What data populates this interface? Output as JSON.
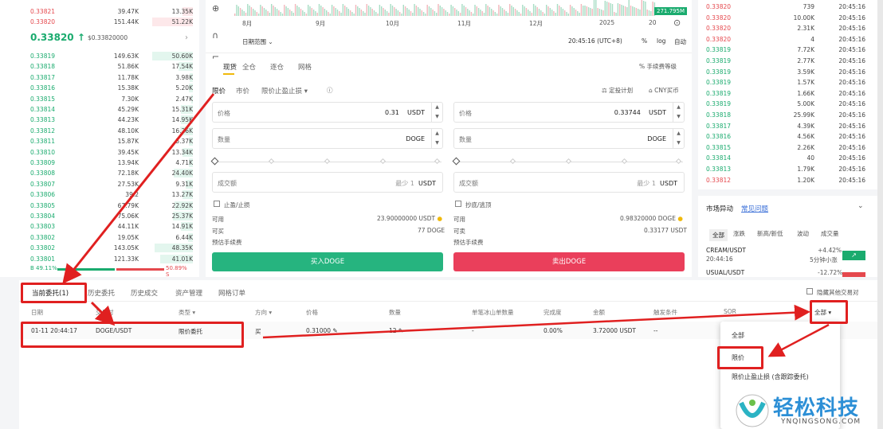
{
  "colors": {
    "red": "#e5484d",
    "green": "#1aab6e",
    "buy_button": "#26b47f",
    "sell_button": "#ea3f5b",
    "annotation": "#e02020"
  },
  "orderbook_left": {
    "asks_top": [
      {
        "price": "0.33821",
        "qty": "39.47K",
        "total": "13.35K"
      },
      {
        "price": "0.33820",
        "qty": "151.44K",
        "total": "51.22K"
      }
    ],
    "mid_price": "0.33820",
    "mid_arrow": "↑",
    "mid_sub": "$0.33820000",
    "bids": [
      {
        "price": "0.33819",
        "qty": "149.63K",
        "total": "50.60K"
      },
      {
        "price": "0.33818",
        "qty": "51.86K",
        "total": "17.54K"
      },
      {
        "price": "0.33817",
        "qty": "11.78K",
        "total": "3.98K"
      },
      {
        "price": "0.33816",
        "qty": "15.38K",
        "total": "5.20K"
      },
      {
        "price": "0.33815",
        "qty": "7.30K",
        "total": "2.47K"
      },
      {
        "price": "0.33814",
        "qty": "45.29K",
        "total": "15.31K"
      },
      {
        "price": "0.33813",
        "qty": "44.23K",
        "total": "14.95K"
      },
      {
        "price": "0.33812",
        "qty": "48.10K",
        "total": "16.26K"
      },
      {
        "price": "0.33811",
        "qty": "15.87K",
        "total": "5.37K"
      },
      {
        "price": "0.33810",
        "qty": "39.45K",
        "total": "13.34K"
      },
      {
        "price": "0.33809",
        "qty": "13.94K",
        "total": "4.71K"
      },
      {
        "price": "0.33808",
        "qty": "72.18K",
        "total": "24.40K"
      },
      {
        "price": "0.33807",
        "qty": "27.53K",
        "total": "9.31K"
      },
      {
        "price": "0.33806",
        "qty": "39.2",
        "total": "13.27K"
      },
      {
        "price": "0.33805",
        "qty": "67.79K",
        "total": "22.92K"
      },
      {
        "price": "0.33804",
        "qty": "75.06K",
        "total": "25.37K"
      },
      {
        "price": "0.33803",
        "qty": "44.11K",
        "total": "14.91K"
      },
      {
        "price": "0.33802",
        "qty": "19.05K",
        "total": "6.44K"
      },
      {
        "price": "0.33802",
        "qty": "143.05K",
        "total": "48.35K"
      },
      {
        "price": "0.33801",
        "qty": "121.33K",
        "total": "41.01K"
      }
    ],
    "ratio_buy": "B 49.11%",
    "ratio_sell": "50.89% S"
  },
  "center": {
    "volume_badge": "271.795M",
    "x_ticks": [
      "8月",
      "9月",
      "10月",
      "11月",
      "12月",
      "2025",
      "20"
    ],
    "date_range": "日期范围",
    "time": "20:45:16 (UTC+8)",
    "percent": "%",
    "log": "log",
    "auto": "自动",
    "mode_tabs": [
      "现货",
      "全仓",
      "逐仓",
      "网格"
    ],
    "fee_level": "手续费等级",
    "order_types": [
      "限价",
      "市价",
      "限价止盈止损"
    ],
    "strategy": "定投计划",
    "cny": "CNY买币",
    "buy_form": {
      "price_label": "价格",
      "price_value": "0.31",
      "price_unit": "USDT",
      "qty_label": "数量",
      "qty_unit": "DOGE",
      "amount_label": "成交额",
      "amount_hint": "最少 1",
      "amount_unit": "USDT",
      "tpsl": "止盈/止损",
      "avail_label": "可用",
      "avail_value": "23.90000000 USDT",
      "can_buy_label": "可买",
      "can_buy_value": "77 DOGE",
      "fee_label": "预估手续费",
      "button": "买入DOGE"
    },
    "sell_form": {
      "price_label": "价格",
      "price_value": "0.33744",
      "price_unit": "USDT",
      "qty_label": "数量",
      "qty_unit": "DOGE",
      "amount_label": "成交额",
      "amount_hint": "最少 1",
      "amount_unit": "USDT",
      "tpsl": "抄底/逃顶",
      "avail_label": "可用",
      "avail_value": "0.98320000 DOGE",
      "can_sell_label": "可卖",
      "can_sell_value": "0.33177 USDT",
      "fee_label": "预估手续费",
      "button": "卖出DOGE"
    }
  },
  "orderbook_right": [
    {
      "price": "0.33820",
      "qty": "739",
      "time": "20:45:16"
    },
    {
      "price": "0.33820",
      "qty": "10.00K",
      "time": "20:45:16"
    },
    {
      "price": "0.33820",
      "qty": "2.31K",
      "time": "20:45:16"
    },
    {
      "price": "0.33820",
      "qty": "4",
      "time": "20:45:16"
    },
    {
      "price": "0.33819",
      "qty": "7.72K",
      "time": "20:45:16"
    },
    {
      "price": "0.33819",
      "qty": "2.77K",
      "time": "20:45:16"
    },
    {
      "price": "0.33819",
      "qty": "3.59K",
      "time": "20:45:16"
    },
    {
      "price": "0.33819",
      "qty": "1.57K",
      "time": "20:45:16"
    },
    {
      "price": "0.33819",
      "qty": "1.66K",
      "time": "20:45:16"
    },
    {
      "price": "0.33819",
      "qty": "5.00K",
      "time": "20:45:16"
    },
    {
      "price": "0.33818",
      "qty": "25.99K",
      "time": "20:45:16"
    },
    {
      "price": "0.33817",
      "qty": "4.39K",
      "time": "20:45:16"
    },
    {
      "price": "0.33816",
      "qty": "4.56K",
      "time": "20:45:16"
    },
    {
      "price": "0.33815",
      "qty": "2.26K",
      "time": "20:45:16"
    },
    {
      "price": "0.33814",
      "qty": "40",
      "time": "20:45:16"
    },
    {
      "price": "0.33813",
      "qty": "1.79K",
      "time": "20:45:16"
    },
    {
      "price": "0.33812",
      "qty": "1.20K",
      "time": "20:45:16"
    }
  ],
  "market": {
    "title": "市场异动",
    "link": "常见问题",
    "tabs": [
      "全部",
      "涨跌",
      "新高/新低",
      "波动",
      "成交量"
    ],
    "items": [
      {
        "pair": "CREAM/USDT",
        "time": "20:44:16",
        "change": "+4.42%",
        "desc": "5分钟小涨"
      },
      {
        "pair": "USUAL/USDT",
        "change": "-12.72%"
      }
    ]
  },
  "bottom": {
    "tabs": [
      "当前委托(1)",
      "历史委托",
      "历史成交",
      "资产管理",
      "网格订单"
    ],
    "hide_others": "隐藏其他交易对",
    "columns": [
      "日期",
      "交易对",
      "类型",
      "方向",
      "价格",
      "数量",
      "单笔冰山单数量",
      "完成度",
      "金额",
      "触发条件",
      "SOR",
      "全部"
    ],
    "row": {
      "date": "01-11 20:44:17",
      "pair": "DOGE/USDT",
      "type": "限价委托",
      "side": "买",
      "price": "0.31000",
      "qty": "12",
      "iceberg": "-",
      "done": "0.00%",
      "amount": "3.72000 USDT",
      "trigger": "--"
    }
  },
  "dropdown": {
    "items": [
      "全部",
      "限价",
      "限价止盈止损 (含跟踪委托)"
    ]
  },
  "watermark": {
    "brand": "轻松科技",
    "site": "YNQINGSONG.COM"
  }
}
